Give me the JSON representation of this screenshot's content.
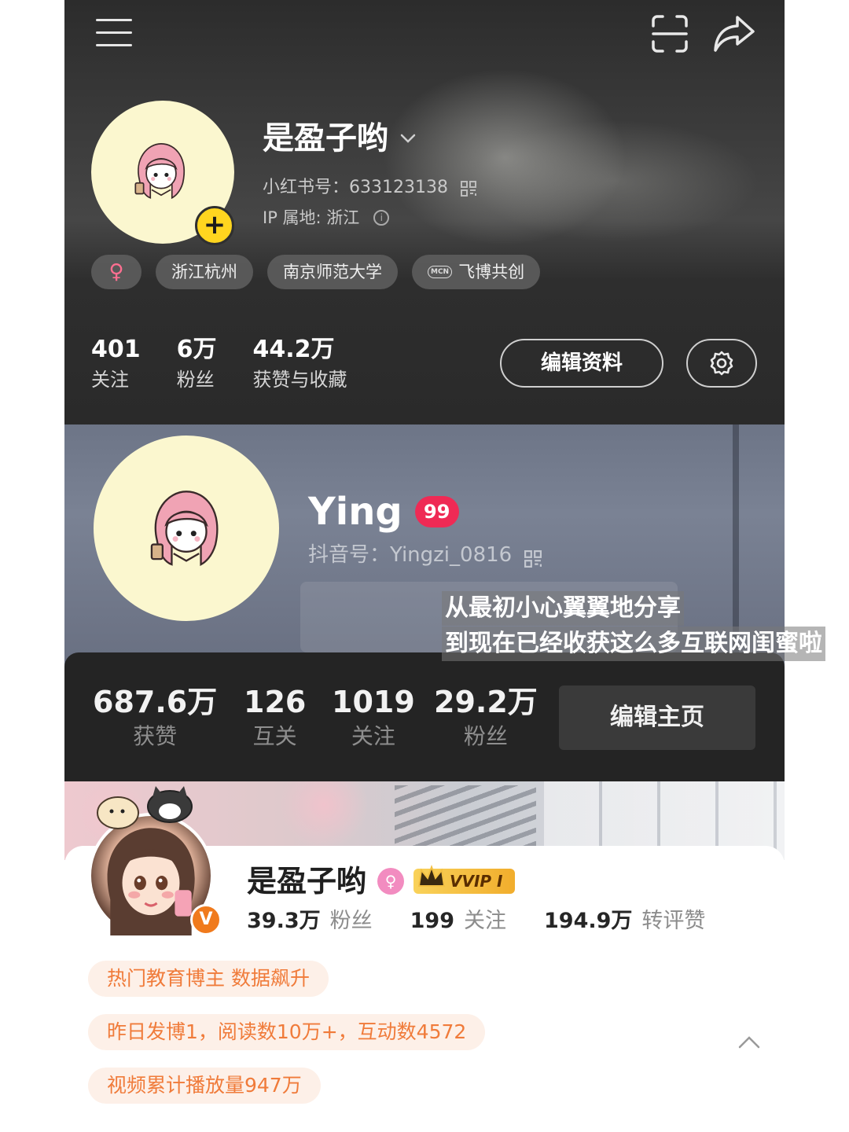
{
  "xhs": {
    "name": "是盈子哟",
    "account_id": "小红书号：633123138",
    "ip_location": "IP 属地: 浙江",
    "tags": [
      "♀",
      "浙江杭州",
      "南京师范大学",
      "飞博共创"
    ],
    "mcn_label": "MCN",
    "stats": [
      {
        "value": "401",
        "label": "关注"
      },
      {
        "value": "6万",
        "label": "粉丝"
      },
      {
        "value": "44.2万",
        "label": "获赞与收藏"
      }
    ],
    "edit_button": "编辑资料",
    "add_badge": "+",
    "icons": [
      "menu-icon",
      "scan-icon",
      "share-icon",
      "chevron-down-icon",
      "qr-code-icon",
      "info-icon",
      "settings-icon"
    ]
  },
  "douyin": {
    "name": "Ying",
    "level": "99",
    "account_id": "抖音号：Yingzi_0816",
    "stats": [
      {
        "value": "687.6万",
        "label": "获赞"
      },
      {
        "value": "126",
        "label": "互关"
      },
      {
        "value": "1019",
        "label": "关注"
      },
      {
        "value": "29.2万",
        "label": "粉丝"
      }
    ],
    "edit_button": "编辑主页",
    "colors": {
      "level_badge": "#ef2a55",
      "stats_bar": "#242424"
    }
  },
  "caption": {
    "line1": "从最初小心翼翼地分享",
    "line2": "到现在已经收获这么多互联网闺蜜啦"
  },
  "weibo": {
    "name": "是盈子哟",
    "gender_symbol": "♀",
    "vip_label": "VVIP I",
    "verified_badge": "V",
    "stats": [
      {
        "value": "39.3万",
        "label": "粉丝"
      },
      {
        "value": "199",
        "label": "关注"
      },
      {
        "value": "194.9万",
        "label": "转评赞"
      }
    ],
    "pills": [
      "热门教育博主 数据飙升",
      "昨日发博1，阅读数10万+，互动数4572",
      "视频累计播放量947万"
    ],
    "colors": {
      "pill_text": "#f07b3a",
      "pill_bg": "#fdf0e8",
      "verified": "#f07a1c"
    }
  }
}
